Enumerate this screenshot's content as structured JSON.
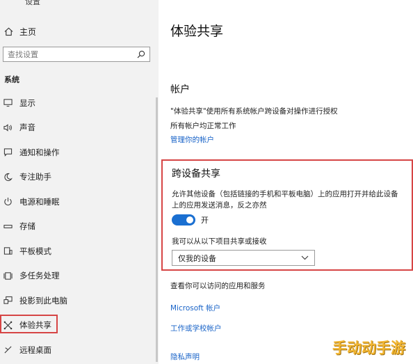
{
  "window": {
    "title": "设置"
  },
  "sidebar": {
    "home_label": "主页",
    "search_placeholder": "查找设置",
    "section_label": "系统",
    "items": [
      {
        "label": "显示",
        "icon": "monitor-icon"
      },
      {
        "label": "声音",
        "icon": "speaker-icon"
      },
      {
        "label": "通知和操作",
        "icon": "notification-icon"
      },
      {
        "label": "专注助手",
        "icon": "moon-icon"
      },
      {
        "label": "电源和睡眠",
        "icon": "power-icon"
      },
      {
        "label": "存储",
        "icon": "storage-icon"
      },
      {
        "label": "平板模式",
        "icon": "tablet-icon"
      },
      {
        "label": "多任务处理",
        "icon": "multitask-icon"
      },
      {
        "label": "投影到此电脑",
        "icon": "project-icon"
      },
      {
        "label": "体验共享",
        "icon": "shared-experiences-icon",
        "active": true
      },
      {
        "label": "远程桌面",
        "icon": "remote-desktop-icon"
      }
    ]
  },
  "main": {
    "page_title": "体验共享",
    "accounts": {
      "title": "帐户",
      "desc1": "\"体验共享\"使用所有系统帐户跨设备对操作进行授权",
      "desc2": "所有帐户均正常工作",
      "manage_link": "管理你的帐户"
    },
    "share_across": {
      "title": "跨设备共享",
      "desc": "允许其他设备（包括链接的手机和平板电脑）上的应用打开并给此设备上的应用发送消息，反之亦然",
      "toggle_state": "开",
      "toggle_on": true,
      "from_label": "我可以从以下项目共享或接收",
      "select_value": "仅我的设备"
    },
    "apps": {
      "title": "查看你可以访问的应用和服务",
      "ms_link": "Microsoft 帐户",
      "work_link": "工作或学校帐户",
      "privacy_link": "隐私声明"
    }
  },
  "watermark": "手动动手游",
  "colors": {
    "accent": "#1a6fd1",
    "highlight": "#d64545",
    "link": "#1a64c8"
  }
}
